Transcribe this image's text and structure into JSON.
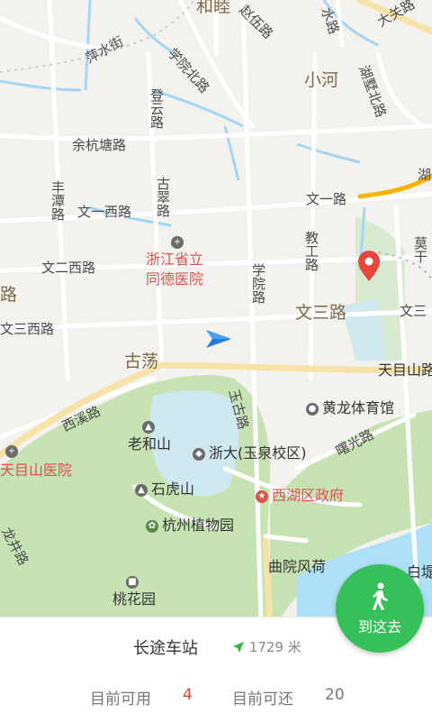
{
  "map": {
    "labels": {
      "hemu": "和睦",
      "zhaowu": "赵伍路",
      "shui": "水路",
      "daguan": "大关路",
      "pingshui": "萍水街",
      "xueyuanbei": "学院北路",
      "xiaohe": "小河",
      "huzhoubei": "湖墅北路",
      "dengyun": "登云路",
      "yuhangtang": "余杭塘路",
      "wenyi": "文一路",
      "fengtan": "丰潭路",
      "wenyixi": "文一西路",
      "gucui": "古翠路",
      "jiaogong": "教工路",
      "mogan": "莫干",
      "hu": "湖",
      "wenerxi": "文二西路",
      "lu": "路",
      "xueyuan": "学院路",
      "wensanxi": "文三西路",
      "wensan": "文三路",
      "wensan2": "文三",
      "gudang": "古荡",
      "tianmushan": "天目山路",
      "yugu": "玉古路",
      "huanglong": "黄龙体育馆",
      "xixi": "西溪路",
      "laoheshan": "老和山",
      "zheda": "浙大(玉泉校区)",
      "shuguang": "曙光路",
      "tianmushan_hospital": "天目山医院",
      "shihushan": "石虎山",
      "xihu_gov": "西湖区政府",
      "botanical": "杭州植物园",
      "longjing": "龙井路",
      "quyuan": "曲院风荷",
      "baidi": "白堤",
      "taohuayuan": "桃花园",
      "tongde1": "浙江省立",
      "tongde2": "同德医院"
    },
    "colors": {
      "background": "#f4f2ee",
      "road": "#ffffff",
      "main_road": "#f7e2a8",
      "highway": "#f5b400",
      "water": "#aee0f7",
      "green": "#c7e3b4",
      "river": "#a3d6f5"
    }
  },
  "station": {
    "name": "长途车站",
    "distance": "1729 米",
    "available_label": "目前可用",
    "available_value": "4",
    "return_label": "目前可还",
    "return_value": "20"
  },
  "go_button": {
    "label": "到这去",
    "icon": "walking-person-icon"
  }
}
